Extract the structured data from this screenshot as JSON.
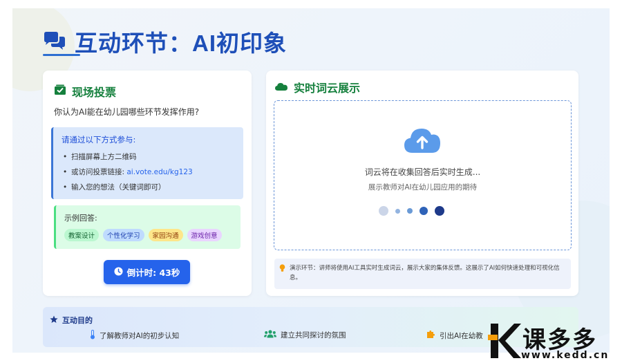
{
  "header": {
    "title": "互动环节：AI初印象",
    "icon": "comments-icon"
  },
  "vote_card": {
    "heading": "现场投票",
    "icon": "vote-icon",
    "question": "你认为AI能在幼儿园哪些环节发挥作用?",
    "participate": {
      "title": "请通过以下方式参与:",
      "items": [
        "扫描屏幕上方二维码",
        "或访问投票链接: ",
        "输入您的想法（关键词即可）"
      ],
      "link": "ai.vote.edu/kg123"
    },
    "examples": {
      "title": "示例回答:",
      "tags": [
        "教案设计",
        "个性化学习",
        "家园沟通",
        "游戏创意"
      ]
    },
    "countdown": {
      "label": "倒计时: 43秒",
      "icon": "clock-icon"
    }
  },
  "cloud_card": {
    "heading": "实时词云展示",
    "icon": "cloud-icon",
    "placeholder_main": "词云将在收集回答后实时生成...",
    "placeholder_sub": "展示教师对AI在幼儿园应用的期待",
    "hint": "演示环节：讲师将使用AI工具实时生成词云，展示大家的集体反馈。这展示了AI如何快速处理和可视化信息。",
    "hint_icon": "lightbulb-icon",
    "dot_colors": [
      "#cbd5e8",
      "#93b4e0",
      "#6a9ad6",
      "#2f63b8",
      "#1e3a8a"
    ]
  },
  "purpose": {
    "title": "互动目的",
    "icon": "star-icon",
    "items": [
      {
        "label": "了解教师对AI的初步认知",
        "icon": "thermometer-icon",
        "color": "#3b82f6"
      },
      {
        "label": "建立共同探讨的氛围",
        "icon": "users-icon",
        "color": "#22a06b"
      },
      {
        "label": "引出AI在幼教",
        "icon": "puzzle-icon",
        "color": "#f59e0b"
      }
    ]
  },
  "watermark": {
    "brand": "课多多",
    "url": "www.kedd.cn"
  },
  "colors": {
    "accent": "#1e4fb8",
    "green": "#15803d",
    "button": "#2563eb"
  }
}
